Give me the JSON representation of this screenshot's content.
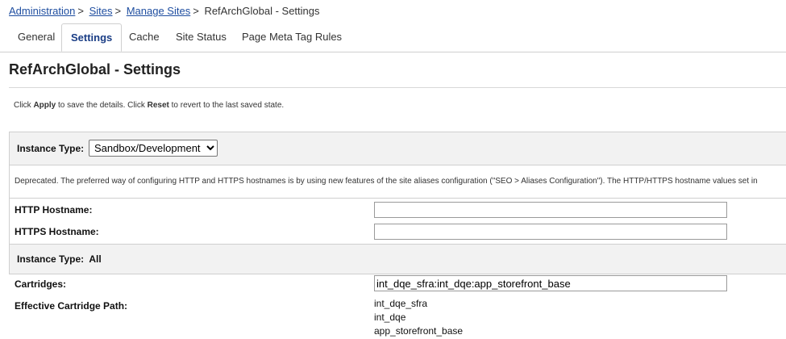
{
  "breadcrumb": {
    "items": [
      {
        "label": "Administration",
        "link": true
      },
      {
        "label": "Sites",
        "link": true
      },
      {
        "label": "Manage Sites",
        "link": true
      },
      {
        "label": "RefArchGlobal - Settings",
        "link": false
      }
    ],
    "separator": ">"
  },
  "tabs": [
    {
      "label": "General",
      "active": false
    },
    {
      "label": "Settings",
      "active": true
    },
    {
      "label": "Cache",
      "active": false
    },
    {
      "label": "Site Status",
      "active": false
    },
    {
      "label": "Page Meta Tag Rules",
      "active": false
    }
  ],
  "page": {
    "title": "RefArchGlobal - Settings",
    "help": {
      "t1": "Click ",
      "apply": "Apply",
      "t2": " to save the details. Click ",
      "reset": "Reset",
      "t3": " to revert to the last saved state."
    }
  },
  "instance_type": {
    "label": "Instance Type:",
    "selected": "Sandbox/Development"
  },
  "deprecated_note": "Deprecated. The preferred way of configuring HTTP and HTTPS hostnames is by using new features of the site aliases configuration (\"SEO > Aliases Configuration\"). The HTTP/HTTPS hostname values set in",
  "hostnames": {
    "http_label": "HTTP Hostname:",
    "http_value": "",
    "https_label": "HTTPS Hostname:",
    "https_value": ""
  },
  "instance_all": {
    "label": "Instance Type:",
    "value": "All"
  },
  "cartridges": {
    "label": "Cartridges:",
    "value": "int_dqe_sfra:int_dqe:app_storefront_base",
    "effective_label": "Effective Cartridge Path:",
    "effective_path": [
      "int_dqe_sfra",
      "int_dqe",
      "app_storefront_base"
    ]
  }
}
